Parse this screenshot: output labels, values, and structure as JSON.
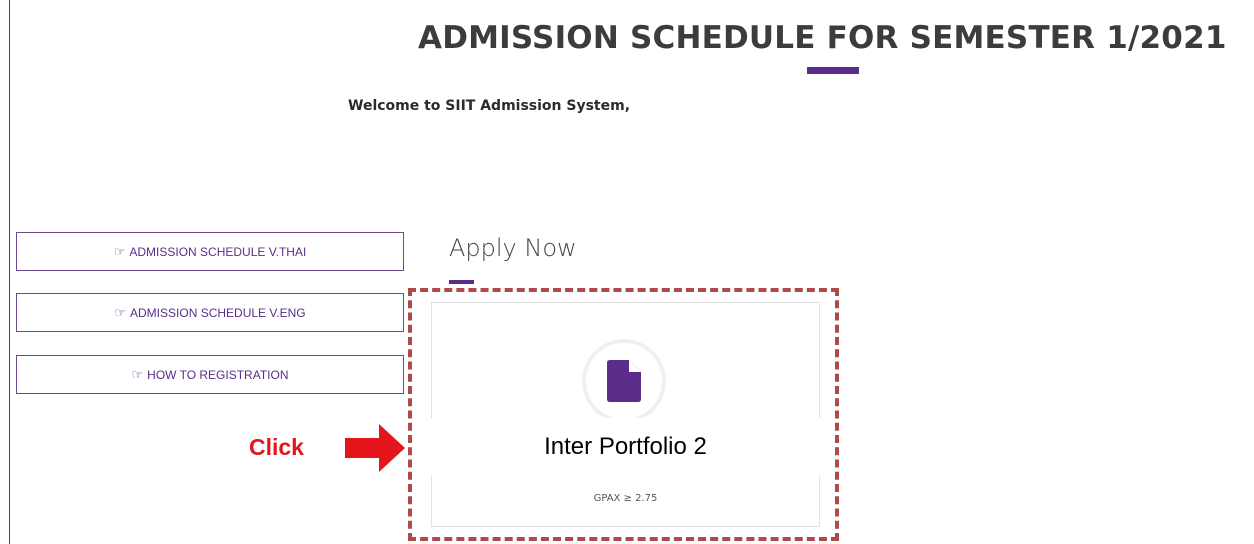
{
  "header": {
    "title": "ADMISSION SCHEDULE FOR SEMESTER 1/2021",
    "welcome": "Welcome to SIIT Admission System,"
  },
  "sidebar": {
    "buttons": [
      {
        "label": "ADMISSION SCHEDULE V.THAI",
        "icon": "hand-point-right-icon"
      },
      {
        "label": "ADMISSION SCHEDULE V.ENG",
        "icon": "hand-point-right-icon"
      },
      {
        "label": "HOW TO REGISTRATION",
        "icon": "hand-point-right-icon"
      }
    ]
  },
  "apply": {
    "heading": "Apply Now",
    "card": {
      "title": "Inter Portfolio 2",
      "subtitle": "GPAX ≥ 2.75",
      "icon": "document-icon"
    }
  },
  "annotation": {
    "click_label": "Click",
    "arrow_icon": "right-arrow-icon"
  },
  "colors": {
    "brand_purple": "#5b2d8b",
    "annotation_red": "#e3141a",
    "frame_red": "#b04a4a",
    "title_text": "#3c3c3c"
  }
}
